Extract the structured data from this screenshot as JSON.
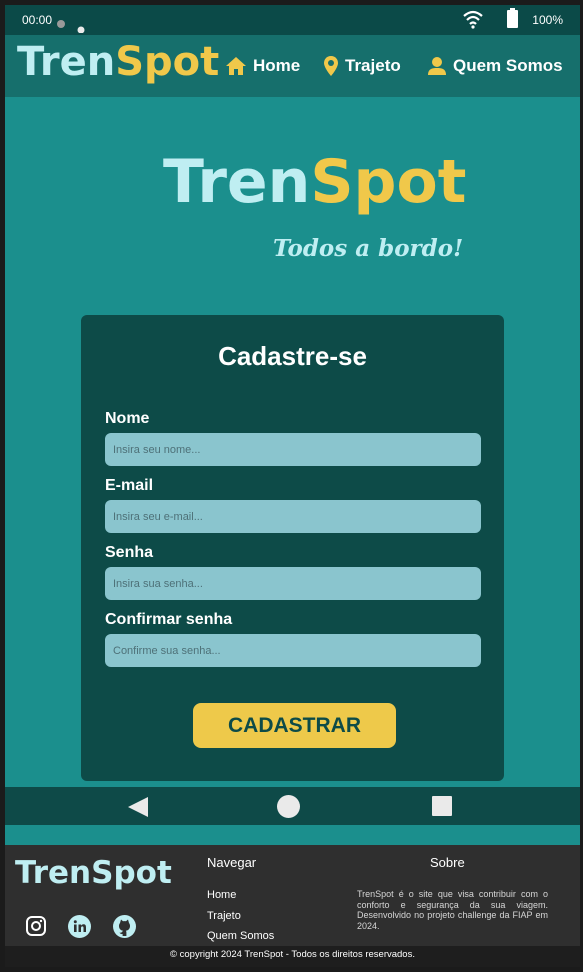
{
  "status_bar": {
    "time": "00:00",
    "battery": "100%"
  },
  "header": {
    "logo": {
      "part1": "Tren",
      "part2": "Spot"
    },
    "nav": [
      {
        "label": "Home",
        "icon": "home-icon"
      },
      {
        "label": "Trajeto",
        "icon": "map-pin-icon"
      },
      {
        "label": "Quem Somos",
        "icon": "user-icon"
      }
    ]
  },
  "hero": {
    "logo": {
      "part1": "Tren",
      "part2": "Spot"
    },
    "tagline": "Todos a bordo!"
  },
  "form": {
    "title": "Cadastre-se",
    "fields": [
      {
        "label": "Nome",
        "placeholder": "Insira seu nome..."
      },
      {
        "label": "E-mail",
        "placeholder": "Insira seu e-mail..."
      },
      {
        "label": "Senha",
        "placeholder": "Insira sua senha..."
      },
      {
        "label": "Confirmar senha",
        "placeholder": "Confirme sua senha..."
      }
    ],
    "submit_label": "CADASTRAR"
  },
  "footer": {
    "logo": {
      "part1": "Tren",
      "part2": "Spot"
    },
    "nav_title": "Navegar",
    "links": [
      "Home",
      "Trajeto",
      "Quem Somos"
    ],
    "about_title": "Sobre",
    "about_text": "TrenSpot é o site que visa contribuir com o conforto e segurança da sua viagem. Desenvolvido no projeto challenge da FIAP em 2024.",
    "social_icons": [
      "instagram-icon",
      "linkedin-icon",
      "github-icon"
    ],
    "copyright": "© copyright 2024 TrenSpot - Todos os direitos reservados."
  },
  "colors": {
    "primary": "#1b8f8d",
    "dark": "#0d4b48",
    "accent": "#eec94a",
    "light": "#bfeef2"
  }
}
